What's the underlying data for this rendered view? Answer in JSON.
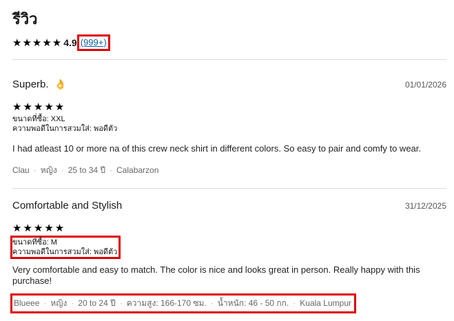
{
  "page": {
    "title": "รีวิว"
  },
  "summary": {
    "stars": "★★★★★",
    "average": "4.9",
    "count": "(999+)"
  },
  "reviews": [
    {
      "title": "Superb.",
      "emoji": "👌",
      "date": "01/01/2026",
      "stars": "★★★★★",
      "size": "ขนาดที่ซื้อ: XXL",
      "fit": "ความพอดีในการสวมใส่: พอดีตัว",
      "text": "I had atleast 10 or more na of this crew neck shirt in different colors. So easy to pair and comfy to wear.",
      "reviewer": [
        "Clau",
        "หญิง",
        "25 to 34 ปี",
        "Calabarzon"
      ]
    },
    {
      "title": "Comfortable and Stylish",
      "date": "31/12/2025",
      "stars": "★★★★★",
      "size": "ขนาดที่ซื้อ: M",
      "fit": "ความพอดีในการสวมใส่: พอดีตัว",
      "text": "Very comfortable and easy to match. The color is nice and looks great in person. Really happy with this purchase!",
      "reviewer": [
        "Blueee",
        "หญิง",
        "20 to 24 ปี",
        "ความสูง: 166-170 ซม.",
        "น้ำหนัก: 46 - 50 กก.",
        "Kuala Lumpur"
      ]
    }
  ]
}
